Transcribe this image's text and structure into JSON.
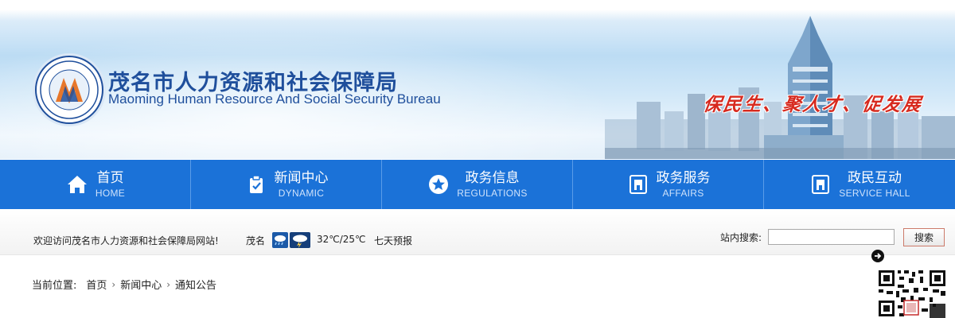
{
  "header": {
    "title_cn": "茂名市人力资源和社会保障局",
    "title_en": "Maoming Human Resource And Social Security Bureau",
    "slogan": "保民生、聚人才、促发展"
  },
  "nav": {
    "items": [
      {
        "label": "首页",
        "sub": "HOME",
        "icon": "home-icon"
      },
      {
        "label": "新闻中心",
        "sub": "DYNAMIC",
        "icon": "clipboard-check-icon"
      },
      {
        "label": "政务信息",
        "sub": "REGULATIONS",
        "icon": "star-icon"
      },
      {
        "label": "政务服务",
        "sub": "AFFAIRS",
        "icon": "building-icon"
      },
      {
        "label": "政民互动",
        "sub": "SERVICE HALL",
        "icon": "building-icon"
      }
    ]
  },
  "infobar": {
    "welcome": "欢迎访问茂名市人力资源和社会保障局网站!",
    "weather_city": "茂名",
    "weather_icons": [
      "rain-icon",
      "thunderstorm-icon"
    ],
    "temperature": "32℃/25℃",
    "forecast_link": "七天预报",
    "search_label": "站内搜索:",
    "search_value": "",
    "search_button": "搜索"
  },
  "breadcrumb": {
    "label": "当前位置:",
    "items": [
      "首页",
      "新闻中心",
      "通知公告"
    ]
  },
  "colors": {
    "brand_blue": "#1b72d8",
    "title_blue": "#1f4f9c",
    "slogan_red": "#d72a1f"
  }
}
